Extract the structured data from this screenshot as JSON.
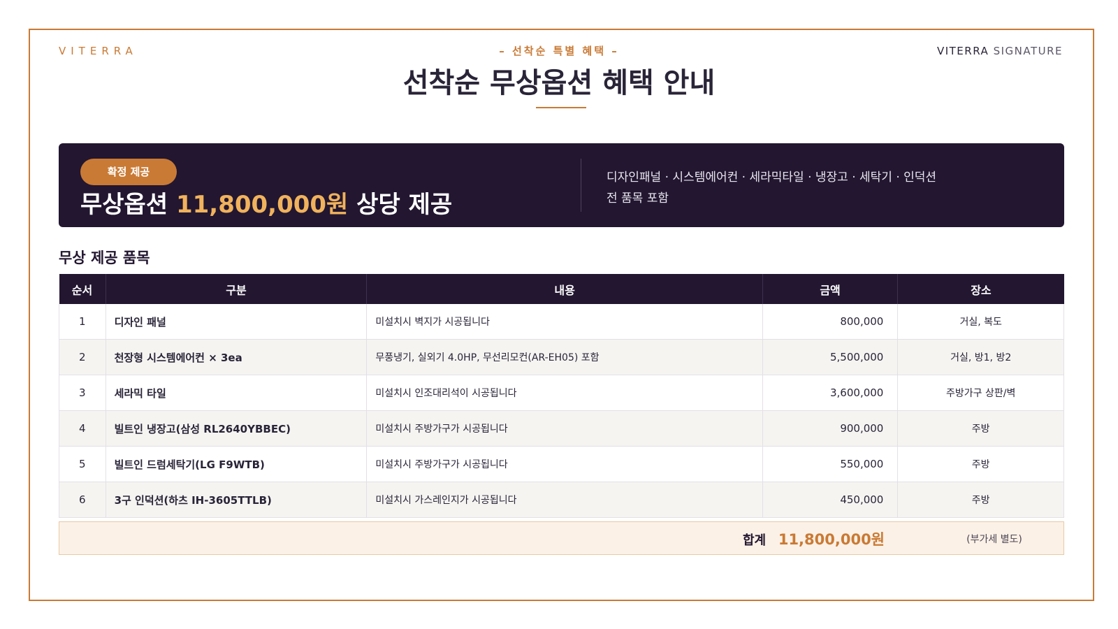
{
  "header": {
    "brand_left": "VITERRA",
    "brand_right_main": "VITERRA",
    "brand_right_sub": "SIGNATURE",
    "eyebrow": "–  선착순 특별 혜택  –",
    "title": "선착순 무상옵션 혜택 안내"
  },
  "banner": {
    "badge": "확정 제공",
    "headline_prefix": "무상옵션 ",
    "headline_amount": "11,800,000원",
    "headline_suffix": " 상당 제공",
    "desc_line1": "디자인패널 · 시스템에어컨 · 세라믹타일 · 냉장고 · 세탁기 · 인덕션",
    "desc_line2": "전 품목 포함"
  },
  "section_title": "무상 제공 품목",
  "table": {
    "headers": [
      "순서",
      "구분",
      "내용",
      "금액",
      "장소"
    ],
    "rows": [
      {
        "no": "1",
        "category": "디자인 패널",
        "description": "미설치시 벽지가 시공됩니다",
        "amount": "800,000",
        "location": "거실, 복도"
      },
      {
        "no": "2",
        "category": "천장형 시스템에어컨 × 3ea",
        "description": "무풍냉기, 실외기 4.0HP, 무선리모컨(AR-EH05) 포함",
        "amount": "5,500,000",
        "location": "거실, 방1, 방2"
      },
      {
        "no": "3",
        "category": "세라믹 타일",
        "description": "미설치시 인조대리석이 시공됩니다",
        "amount": "3,600,000",
        "location": "주방가구 상판/벽"
      },
      {
        "no": "4",
        "category": "빌트인 냉장고(삼성 RL2640YBBEC)",
        "description": "미설치시 주방가구가 시공됩니다",
        "amount": "900,000",
        "location": "주방"
      },
      {
        "no": "5",
        "category": "빌트인 드럼세탁기(LG F9WTB)",
        "description": "미설치시 주방가구가 시공됩니다",
        "amount": "550,000",
        "location": "주방"
      },
      {
        "no": "6",
        "category": "3구 인덕션(하츠 IH-3605TTLB)",
        "description": "미설치시 가스레인지가 시공됩니다",
        "amount": "450,000",
        "location": "주방"
      }
    ]
  },
  "total": {
    "label": "합계",
    "amount": "11,800,000원",
    "note": "(부가세 별도)"
  },
  "colors": {
    "accent": "#c97a35",
    "navy": "#221630",
    "highlight": "#f0b25c"
  }
}
